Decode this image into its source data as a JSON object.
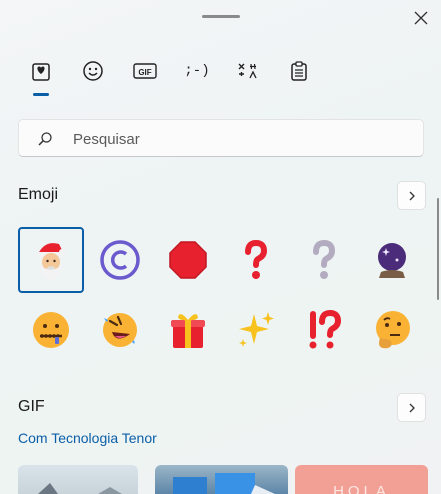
{
  "tabs": [
    {
      "name": "favorites",
      "icon": "heart-clipboard-icon"
    },
    {
      "name": "emoji",
      "icon": "smiley-icon"
    },
    {
      "name": "gif",
      "icon": "gif-icon",
      "label": "GIF"
    },
    {
      "name": "kaomoji",
      "icon": "kaomoji-icon",
      "label": ";-)"
    },
    {
      "name": "symbols",
      "icon": "symbols-icon"
    },
    {
      "name": "clipboard",
      "icon": "clipboard-icon"
    }
  ],
  "search": {
    "placeholder": "Pesquisar"
  },
  "emoji_section": {
    "title": "Emoji",
    "items": [
      "santa",
      "copyright",
      "stop-sign",
      "red-question-mark",
      "white-question-mark",
      "crystal-ball",
      "zipper-mouth-face",
      "rolling-on-floor-laughing",
      "wrapped-gift",
      "sparkles",
      "exclamation-question-mark",
      "thinking-face"
    ],
    "selected_index": 0
  },
  "gif_section": {
    "title": "GIF",
    "provider": "Com Tecnologia Tenor",
    "thumb_text": "HOLA"
  },
  "colors": {
    "accent": "#0a5ea8",
    "red": "#e8212f"
  }
}
